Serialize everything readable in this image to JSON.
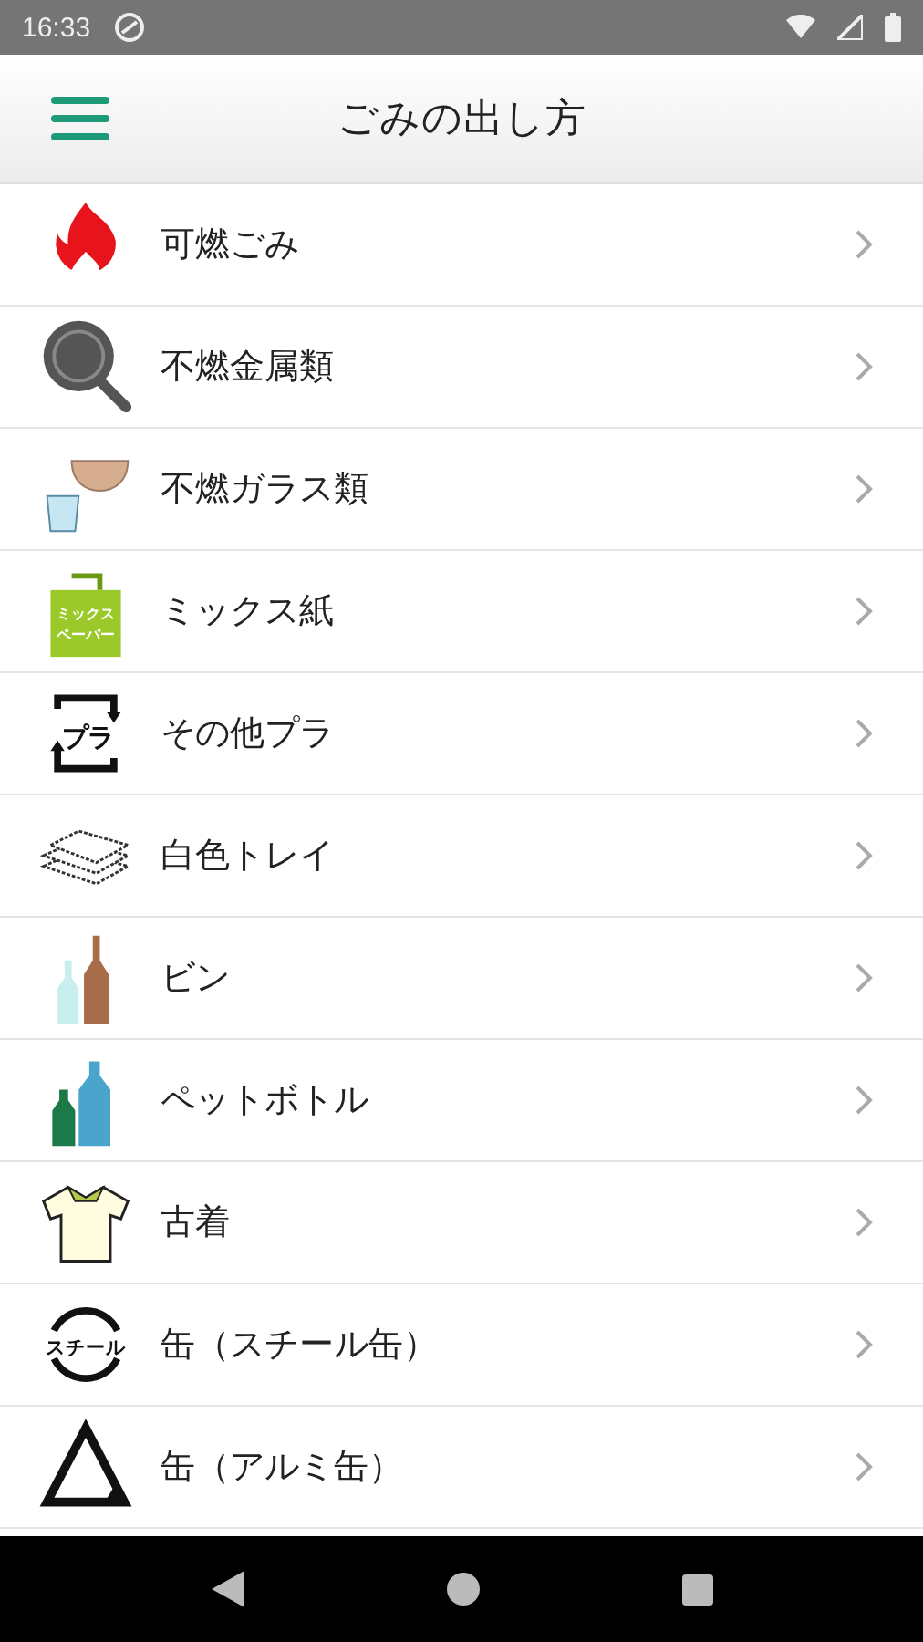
{
  "status_bar": {
    "time": "16:33"
  },
  "app_bar": {
    "title": "ごみの出し方"
  },
  "items": [
    {
      "label": "可燃ごみ",
      "kind": "flame"
    },
    {
      "label": "不燃金属類",
      "kind": "pan"
    },
    {
      "label": "不燃ガラス類",
      "kind": "glass"
    },
    {
      "label": "ミックス紙",
      "kind": "bag",
      "icon_text": [
        "ミックス",
        "ペーパー"
      ]
    },
    {
      "label": "その他プラ",
      "kind": "pla",
      "icon_text": [
        "プラ"
      ]
    },
    {
      "label": "白色トレイ",
      "kind": "tray"
    },
    {
      "label": "ビン",
      "kind": "bottles"
    },
    {
      "label": "ペットボトル",
      "kind": "pet"
    },
    {
      "label": "古着",
      "kind": "shirt"
    },
    {
      "label": "缶（スチール缶）",
      "kind": "steel",
      "icon_text": [
        "スチール"
      ]
    },
    {
      "label": "缶（アルミ缶）",
      "kind": "alu"
    }
  ]
}
